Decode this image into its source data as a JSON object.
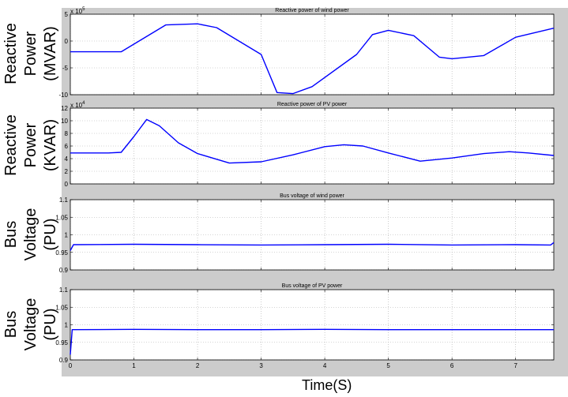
{
  "figure": {
    "xlabel": "Time(S)",
    "background": "#cccccc",
    "axes_background": "#ffffff",
    "line_color": "#0000ff",
    "grid_color": "#aaaaaa"
  },
  "chart_data": [
    {
      "type": "line",
      "title": "Reactive power of wind power",
      "ylabel": [
        "Reactive",
        "Power",
        "(MVAR)"
      ],
      "exponent_label": "x 10^5",
      "xlim": [
        0,
        7.6
      ],
      "ylim": [
        -10,
        5
      ],
      "xticks": [
        0,
        1,
        2,
        3,
        4,
        5,
        6,
        7
      ],
      "xticklabels": [],
      "yticks": [
        -10,
        -5,
        0,
        5
      ],
      "yticklabels": [
        "-10",
        "-5",
        "0",
        "5"
      ],
      "grid": true,
      "series": [
        {
          "x": [
            0,
            0.8,
            1.5,
            2.0,
            2.3,
            3.0,
            3.25,
            3.5,
            3.8,
            4.5,
            4.75,
            5.0,
            5.4,
            5.8,
            6.0,
            6.5,
            7.0,
            7.6
          ],
          "values": [
            -2,
            -2,
            3,
            3.2,
            2.5,
            -2.5,
            -9.6,
            -9.8,
            -8.5,
            -2.5,
            1.2,
            2.0,
            1.0,
            -3.0,
            -3.3,
            -2.7,
            0.7,
            2.4
          ]
        }
      ]
    },
    {
      "type": "line",
      "title": "Reactive power of PV power",
      "ylabel": [
        "Reactive",
        "Power",
        "(KVAR)"
      ],
      "exponent_label": "x 10^4",
      "xlim": [
        0,
        7.6
      ],
      "ylim": [
        0,
        12
      ],
      "xticks": [
        0,
        1,
        2,
        3,
        4,
        5,
        6,
        7
      ],
      "xticklabels": [],
      "yticks": [
        0,
        2,
        4,
        6,
        8,
        10,
        12
      ],
      "yticklabels": [
        "0",
        "2",
        "4",
        "6",
        "8",
        "10",
        "12"
      ],
      "grid": true,
      "series": [
        {
          "x": [
            0,
            0.6,
            0.8,
            1.0,
            1.2,
            1.4,
            1.7,
            2.0,
            2.5,
            3.0,
            3.5,
            4.0,
            4.3,
            4.6,
            5.0,
            5.5,
            6.0,
            6.5,
            6.9,
            7.2,
            7.6
          ],
          "values": [
            4.9,
            4.9,
            5.0,
            7.5,
            10.2,
            9.2,
            6.5,
            4.8,
            3.3,
            3.5,
            4.6,
            5.9,
            6.2,
            6.0,
            4.9,
            3.6,
            4.1,
            4.8,
            5.1,
            4.9,
            4.5
          ]
        }
      ]
    },
    {
      "type": "line",
      "title": "Bus voltage of wind power",
      "ylabel": [
        "Bus",
        "Voltage",
        "(PU)"
      ],
      "xlim": [
        0,
        7.6
      ],
      "ylim": [
        0.9,
        1.1
      ],
      "xticks": [
        0,
        1,
        2,
        3,
        4,
        5,
        6,
        7
      ],
      "xticklabels": [],
      "yticks": [
        0.9,
        0.95,
        1.0,
        1.05,
        1.1
      ],
      "yticklabels": [
        "0.9",
        "0.95",
        "1",
        "1.05",
        "1.1"
      ],
      "grid": true,
      "series": [
        {
          "x": [
            0,
            0.05,
            1.0,
            2.0,
            3.0,
            4.0,
            5.0,
            6.0,
            7.0,
            7.55,
            7.6
          ],
          "values": [
            0.955,
            0.972,
            0.973,
            0.972,
            0.971,
            0.972,
            0.973,
            0.971,
            0.972,
            0.971,
            0.978
          ]
        }
      ]
    },
    {
      "type": "line",
      "title": "Bus voltage of PV power",
      "ylabel": [
        "Bus",
        "Voltage",
        "(PU)"
      ],
      "xlim": [
        0,
        7.6
      ],
      "ylim": [
        0.9,
        1.1
      ],
      "xticks": [
        0,
        1,
        2,
        3,
        4,
        5,
        6,
        7
      ],
      "xticklabels": [
        "0",
        "1",
        "2",
        "3",
        "4",
        "5",
        "6",
        "7"
      ],
      "yticks": [
        0.9,
        0.95,
        1.0,
        1.05,
        1.1
      ],
      "yticklabels": [
        "0.9",
        "0.95",
        "1",
        "1.05",
        "1.1"
      ],
      "grid": true,
      "series": [
        {
          "x": [
            0,
            0.03,
            1.0,
            2.0,
            3.0,
            4.0,
            5.0,
            6.0,
            7.0,
            7.6
          ],
          "values": [
            0.915,
            0.986,
            0.987,
            0.986,
            0.986,
            0.987,
            0.986,
            0.986,
            0.986,
            0.986
          ]
        }
      ]
    }
  ]
}
